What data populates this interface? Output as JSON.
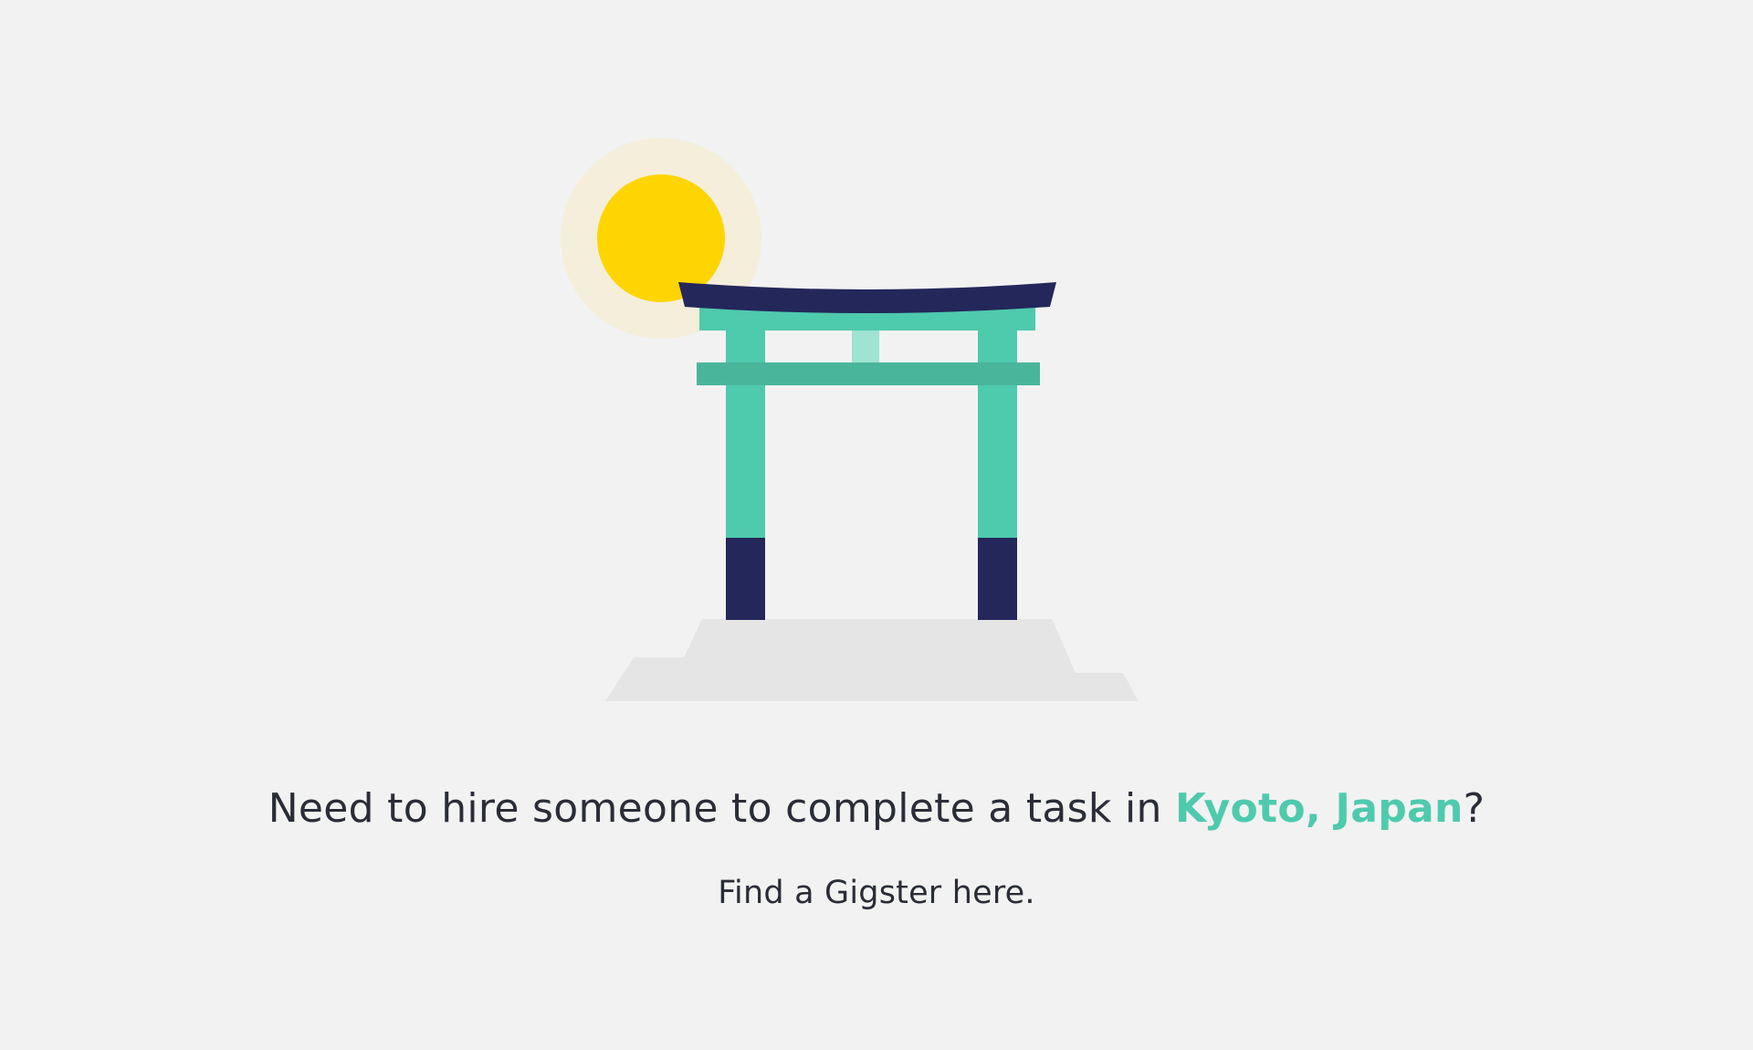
{
  "colors": {
    "background": "#f2f2f2",
    "text": "#2a2d37",
    "accent": "#4ecaad",
    "sun": "#ffd500",
    "sun_glow": "#f5eedb",
    "gate_teal": "#4ecaad",
    "gate_navy": "#23275a",
    "ground": "#e5e5e5"
  },
  "illustration": {
    "icons": [
      "sun-icon",
      "torii-gate-icon",
      "ground-platform"
    ]
  },
  "headline": {
    "prefix": "Need to hire someone to complete a task in ",
    "place": "Kyoto, Japan",
    "suffix": "?"
  },
  "cta": {
    "label": "Find a Gigster here."
  }
}
